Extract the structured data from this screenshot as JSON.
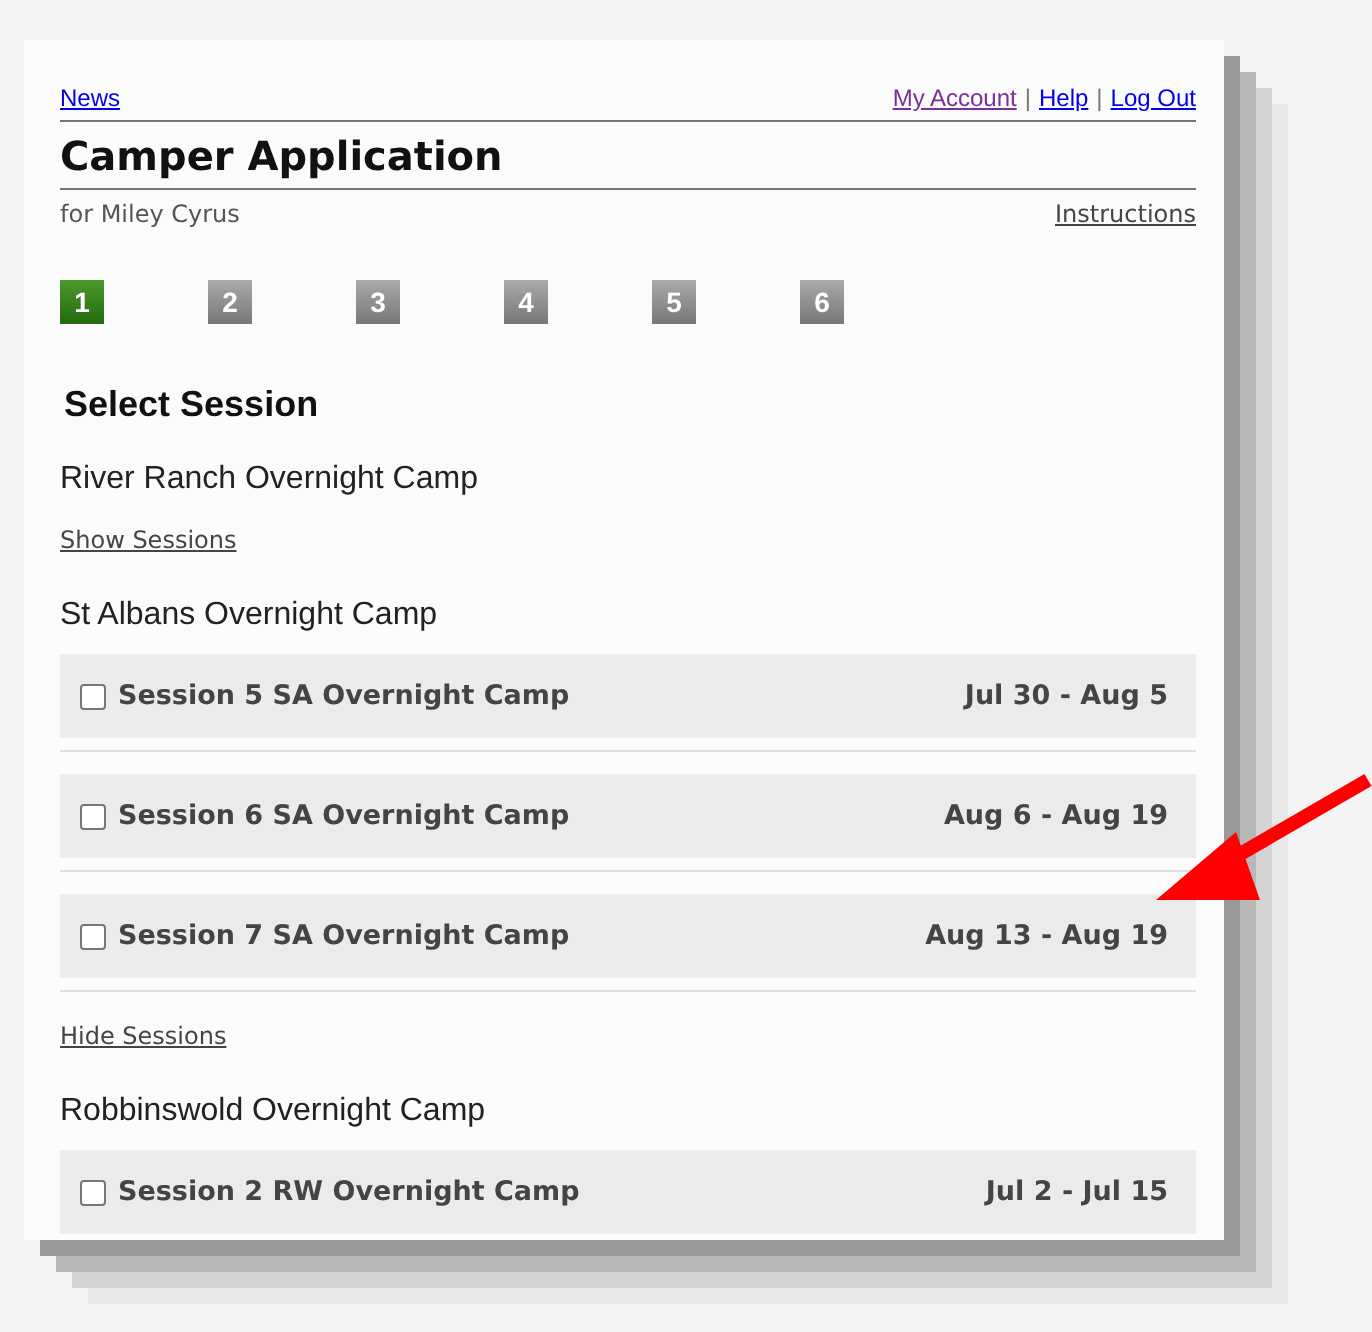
{
  "top_links": {
    "left": "News",
    "right": [
      "My Account",
      "Help",
      "Log Out"
    ],
    "separator": "|"
  },
  "title": "Camper Application",
  "subtitle": "for Miley Cyrus",
  "instructions_link": "Instructions",
  "steps": [
    {
      "label": "1",
      "selected": true
    },
    {
      "label": "2",
      "selected": false
    },
    {
      "label": "3",
      "selected": false
    },
    {
      "label": "4",
      "selected": false
    },
    {
      "label": "5",
      "selected": false
    },
    {
      "label": "6",
      "selected": false
    }
  ],
  "section_heading": "Select Session",
  "camps": [
    {
      "name": "River Ranch Overnight Camp",
      "toggle": "Show Sessions"
    },
    {
      "name": "St Albans Overnight Camp",
      "toggle": "Hide Sessions",
      "sessions": [
        {
          "name": "Session 5 SA Overnight Camp",
          "dates": "Jul 30 - Aug 5",
          "checked": false
        },
        {
          "name": "Session 6 SA Overnight Camp",
          "dates": "Aug 6 - Aug 19",
          "checked": false
        },
        {
          "name": "Session 7 SA Overnight Camp",
          "dates": "Aug 13 - Aug 19",
          "checked": false
        }
      ]
    },
    {
      "name": "Robbinswold Overnight Camp",
      "sessions": [
        {
          "name": "Session 2 RW Overnight Camp",
          "dates": "Jul 2 - Jul 15",
          "checked": false
        }
      ]
    }
  ]
}
